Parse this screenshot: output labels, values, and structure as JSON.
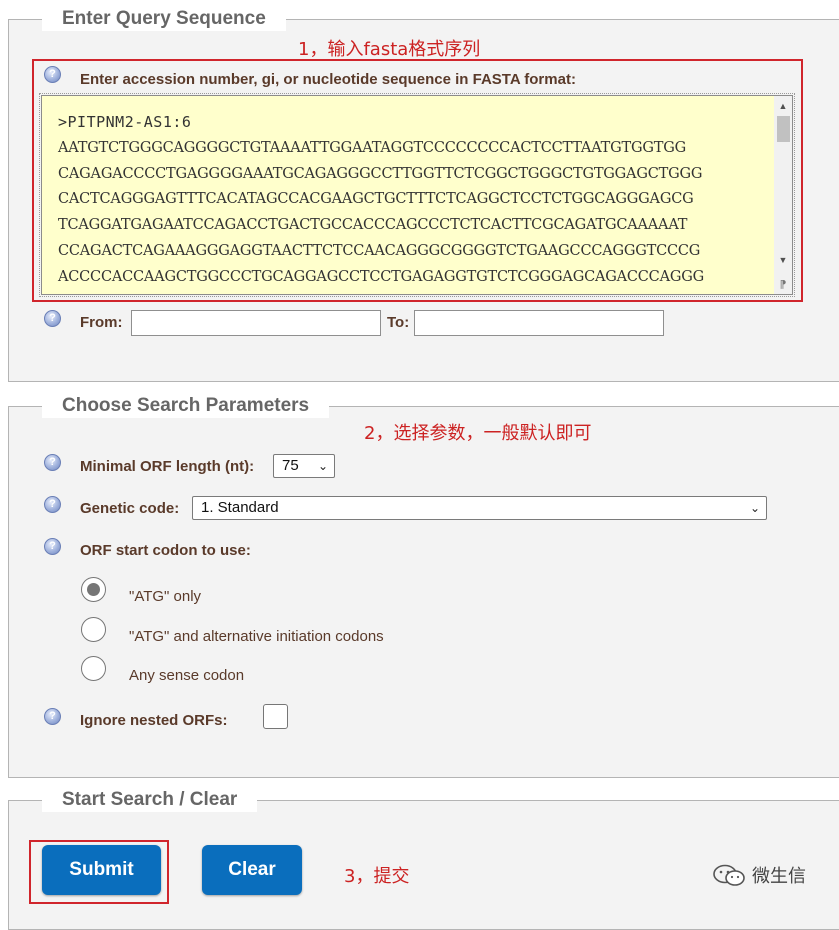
{
  "query_section": {
    "legend": "Enter Query Sequence",
    "annotation": "1，输入fasta格式序列",
    "prompt": "Enter accession number, gi, or nucleotide sequence in FASTA format:",
    "sequence_lines": [
      ">PITPNM2-AS1:6",
      "AATGTCTGGGCAGGGGCTGTAAAATTGGAATAGGTCCCCCCCCACTCCTTAATGTGGTGG",
      "CAGAGACCCCTGAGGGGAAATGCAGAGGGCCTTGGTTCTCGGCTGGGCTGTGGAGCTGGG",
      "CACTCAGGGAGTTTCACATAGCCACGAAGCTGCTTTCTCAGGCTCCTCTGGCAGGGAGCG",
      "TCAGGATGAGAATCCAGACCTGACTGCCACCCAGCCCTCTCACTTCGCAGATGCAAAAAT",
      "CCAGACTCAGAAAGGGAGGTAACTTCTCCAACAGGGCGGGGTCTGAAGCCCAGGGTCCCG",
      "ACCCCACCAAGCTGGCCCTGCAGGAGCCTCCTGAGAGGTGTCTCGGGAGCAGACCCAGGG"
    ],
    "from_label": "From:",
    "from_value": "",
    "to_label": "To:",
    "to_value": ""
  },
  "params_section": {
    "legend": "Choose Search Parameters",
    "annotation": "2，选择参数，一般默认即可",
    "min_orf_label": "Minimal ORF length (nt):",
    "min_orf_value": "75",
    "genetic_code_label": "Genetic code:",
    "genetic_code_value": "1. Standard",
    "start_codon_label": "ORF start codon to use:",
    "start_codon_options": [
      {
        "label": "\"ATG\" only",
        "checked": true
      },
      {
        "label": "\"ATG\" and alternative initiation codons",
        "checked": false
      },
      {
        "label": "Any sense codon",
        "checked": false
      }
    ],
    "ignore_nested_label": "Ignore nested ORFs:",
    "ignore_nested_checked": false
  },
  "submit_section": {
    "legend": "Start Search / Clear",
    "submit_label": "Submit",
    "clear_label": "Clear",
    "annotation": "3，提交"
  },
  "watermark": {
    "icon": "wechat-icon",
    "text": "微生信"
  },
  "colors": {
    "annotation_red": "#d0252c",
    "button_blue": "#0a6ebd",
    "textarea_bg": "#ffffcc",
    "label_brown": "#5a3a2a"
  }
}
